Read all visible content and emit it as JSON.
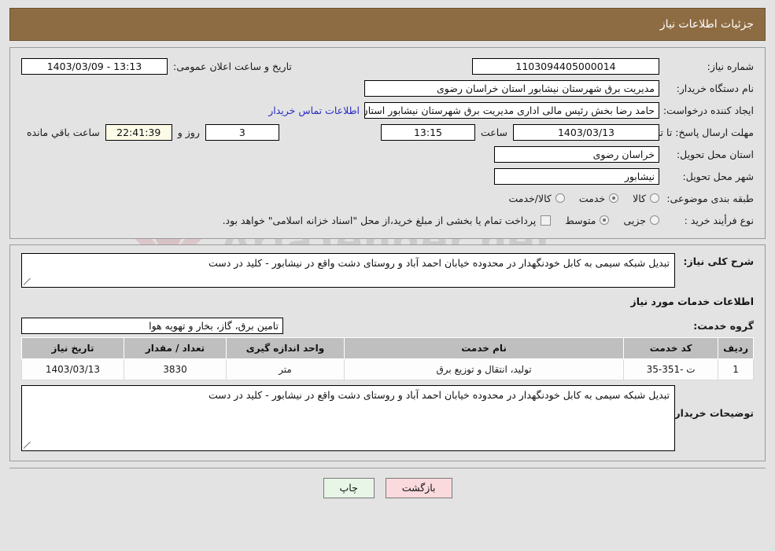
{
  "header": {
    "title": "جزئیات اطلاعات نیاز"
  },
  "form": {
    "need_number_label": "شماره نیاز:",
    "need_number_value": "1103094405000014",
    "announce_label": "تاریخ و ساعت اعلان عمومی:",
    "announce_value": "13:13 - 1403/03/09",
    "buyer_org_label": "نام دستگاه خریدار:",
    "buyer_org_value": "مدیریت برق شهرستان نیشابور استان خراسان رضوی",
    "creator_label": "ایجاد کننده درخواست:",
    "creator_value": "حامد رضا بخش رئیس مالی اداری مدیریت برق شهرستان نیشابور استان خراسان",
    "contact_link": "اطلاعات تماس خریدار",
    "deadline_label": "مهلت ارسال پاسخ: تا تاریخ:",
    "deadline_date": "1403/03/13",
    "deadline_hour_label": "ساعت",
    "deadline_hour": "13:15",
    "remaining_days": "3",
    "days_label": "روز و",
    "remaining_time": "22:41:39",
    "remaining_suffix": "ساعت باقي مانده",
    "province_label": "استان محل تحویل:",
    "province_value": "خراسان رضوی",
    "city_label": "شهر محل تحویل:",
    "city_value": "نیشابور",
    "category_label": "طبقه بندی موضوعی:",
    "category_options": [
      {
        "label": "کالا",
        "selected": false
      },
      {
        "label": "خدمت",
        "selected": true
      },
      {
        "label": "کالا/خدمت",
        "selected": false
      }
    ],
    "process_label": "نوع فرأیند خرید :",
    "process_options": [
      {
        "label": "جزیی",
        "selected": false
      },
      {
        "label": "متوسط",
        "selected": true
      }
    ],
    "treasury_note": "پرداخت تمام یا بخشی از مبلغ خرید،از محل \"اسناد خزانه اسلامی\" خواهد بود."
  },
  "description": {
    "label": "شرح کلی نیاز:",
    "value": "تبدیل شبکه سیمی به کابل خودنگهدار در محدوده خیابان احمد آباد و روستای دشت واقع در نیشابور - کلید در دست",
    "section_title": "اطلاعات خدمات مورد نیاز",
    "service_group_label": "گروه خدمت:",
    "service_group_value": "تامین برق، گاز، بخار و تهویه هوا"
  },
  "table": {
    "columns": [
      "ردیف",
      "کد خدمت",
      "نام خدمت",
      "واحد اندازه گیری",
      "تعداد / مقدار",
      "تاریخ نیاز"
    ],
    "rows": [
      {
        "row_no": "1",
        "service_code": "ت -351-35",
        "service_name": "تولید، انتقال و توزیع برق",
        "unit": "متر",
        "quantity": "3830",
        "need_date": "1403/03/13"
      }
    ]
  },
  "notes": {
    "label": "توضیحات خریدار:",
    "value": "تبدیل شبکه سیمی به کابل خودنگهدار در محدوده خیابان احمد آباد و روستای دشت واقع در نیشابور - کلید در دست"
  },
  "footer": {
    "print_label": "چاپ",
    "back_label": "بازگشت"
  },
  "watermark": {
    "text": "AriaTender.net"
  }
}
